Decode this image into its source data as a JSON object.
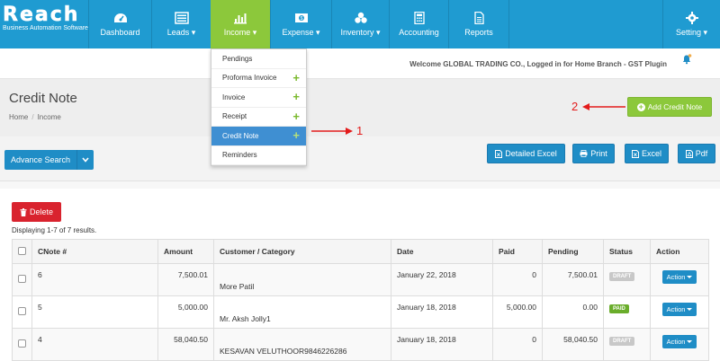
{
  "brand": {
    "logo": "Reach",
    "tagline": "Business Automation Software"
  },
  "nav": [
    {
      "label": "Dashboard",
      "icon": "dashboard-icon"
    },
    {
      "label": "Leads",
      "icon": "list-icon",
      "caret": true
    },
    {
      "label": "Income",
      "icon": "bar-chart-icon",
      "caret": true,
      "active": true
    },
    {
      "label": "Expense",
      "icon": "money-icon",
      "caret": true
    },
    {
      "label": "Inventory",
      "icon": "cubes-icon",
      "caret": true
    },
    {
      "label": "Accounting",
      "icon": "calculator-icon"
    },
    {
      "label": "Reports",
      "icon": "file-icon"
    },
    {
      "label": "Setting",
      "icon": "gear-icon",
      "caret": true
    }
  ],
  "income_menu": [
    {
      "label": "Pendings",
      "plus": false
    },
    {
      "label": "Proforma Invoice",
      "plus": true
    },
    {
      "label": "Invoice",
      "plus": true
    },
    {
      "label": "Receipt",
      "plus": true
    },
    {
      "label": "Credit Note",
      "plus": true,
      "active": true
    },
    {
      "label": "Reminders",
      "plus": false
    }
  ],
  "welcome": "Welcome GLOBAL TRADING CO., Logged in for Home Branch - GST Plugin",
  "page": {
    "title": "Credit Note",
    "breadcrumb": [
      "Home",
      "Income"
    ],
    "add_button": "Add Credit Note"
  },
  "annotations": {
    "one": "1",
    "two": "2"
  },
  "toolbar": {
    "advance_search": "Advance Search",
    "detailed_excel": "Detailed Excel",
    "print": "Print",
    "excel": "Excel",
    "pdf": "Pdf"
  },
  "list": {
    "delete": "Delete",
    "results": "Displaying 1-7 of 7 results.",
    "columns": [
      "CNote #",
      "Amount",
      "Customer / Category",
      "Date",
      "Paid",
      "Pending",
      "Status",
      "Action"
    ],
    "rows": [
      {
        "cnote": "6",
        "amount": "7,500.01",
        "customer": "More Patil",
        "date": "January 22, 2018",
        "paid": "0",
        "pending": "7,500.01",
        "status": "DRAFT",
        "action": "Action"
      },
      {
        "cnote": "5",
        "amount": "5,000.00",
        "customer": "Mr. Aksh Jolly1",
        "date": "January 18, 2018",
        "paid": "5,000.00",
        "pending": "0.00",
        "status": "PAID",
        "action": "Action"
      },
      {
        "cnote": "4",
        "amount": "58,040.50",
        "customer": "KESAVAN VELUTHOOR9846226286",
        "date": "January 18, 2018",
        "paid": "0",
        "pending": "58,040.50",
        "status": "DRAFT",
        "action": "Action"
      }
    ]
  },
  "colors": {
    "nav_bg": "#1f9bd1",
    "active_green": "#8cc83b",
    "primary_btn": "#1f8dc6",
    "danger": "#d9232e",
    "annotation_red": "#e31b1b",
    "draft_badge": "#c8c8c8",
    "paid_badge": "#6aad2b"
  }
}
